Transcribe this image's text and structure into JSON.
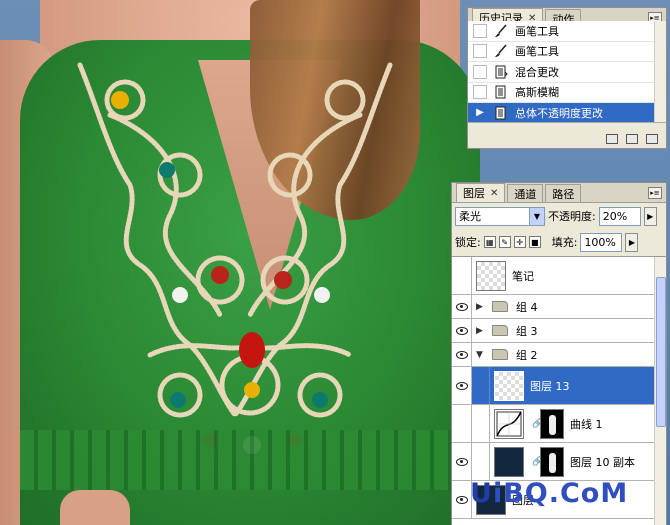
{
  "history_panel": {
    "tabs": [
      {
        "label": "历史记录",
        "active": true,
        "closable": true
      },
      {
        "label": "动作",
        "active": false,
        "closable": false
      }
    ],
    "items": [
      {
        "label": "画笔工具",
        "icon": "brush-icon",
        "selected": false
      },
      {
        "label": "画笔工具",
        "icon": "brush-icon",
        "selected": false
      },
      {
        "label": "混合更改",
        "icon": "document-icon",
        "selected": false
      },
      {
        "label": "高斯模糊",
        "icon": "document-icon",
        "selected": false
      },
      {
        "label": "总体不透明度更改",
        "icon": "document-icon",
        "selected": true
      }
    ],
    "footer_icons": [
      "new-document-from-state-icon",
      "snapshot-camera-icon",
      "trash-icon"
    ]
  },
  "layers_panel": {
    "tabs": [
      {
        "label": "图层",
        "active": true,
        "closable": true
      },
      {
        "label": "通道",
        "active": false
      },
      {
        "label": "路径",
        "active": false
      }
    ],
    "blend_mode": "柔光",
    "opacity_label": "不透明度:",
    "opacity_value": "20%",
    "lock_label": "锁定:",
    "fill_label": "填充:",
    "fill_value": "100%",
    "layers": [
      {
        "name": "笔记",
        "type": "layer",
        "visible": false,
        "thumb": "transparent"
      },
      {
        "name": "组 4",
        "type": "group",
        "visible": true,
        "expanded": false
      },
      {
        "name": "组 3",
        "type": "group",
        "visible": true,
        "expanded": false
      },
      {
        "name": "组 2",
        "type": "group",
        "visible": true,
        "expanded": true
      },
      {
        "name": "图层 13",
        "type": "layer",
        "visible": true,
        "selected": true,
        "thumb": "transparent"
      },
      {
        "name": "曲线 1",
        "type": "adjustment",
        "visible": false,
        "thumb": "curves"
      },
      {
        "name": "图层 10 副本",
        "type": "layer",
        "visible": true,
        "thumb": "dark"
      },
      {
        "name": "图层",
        "type": "layer",
        "visible": true,
        "thumb": "dark"
      }
    ]
  },
  "watermark": {
    "prefix": "U",
    "text": "iBQ.CoM"
  }
}
